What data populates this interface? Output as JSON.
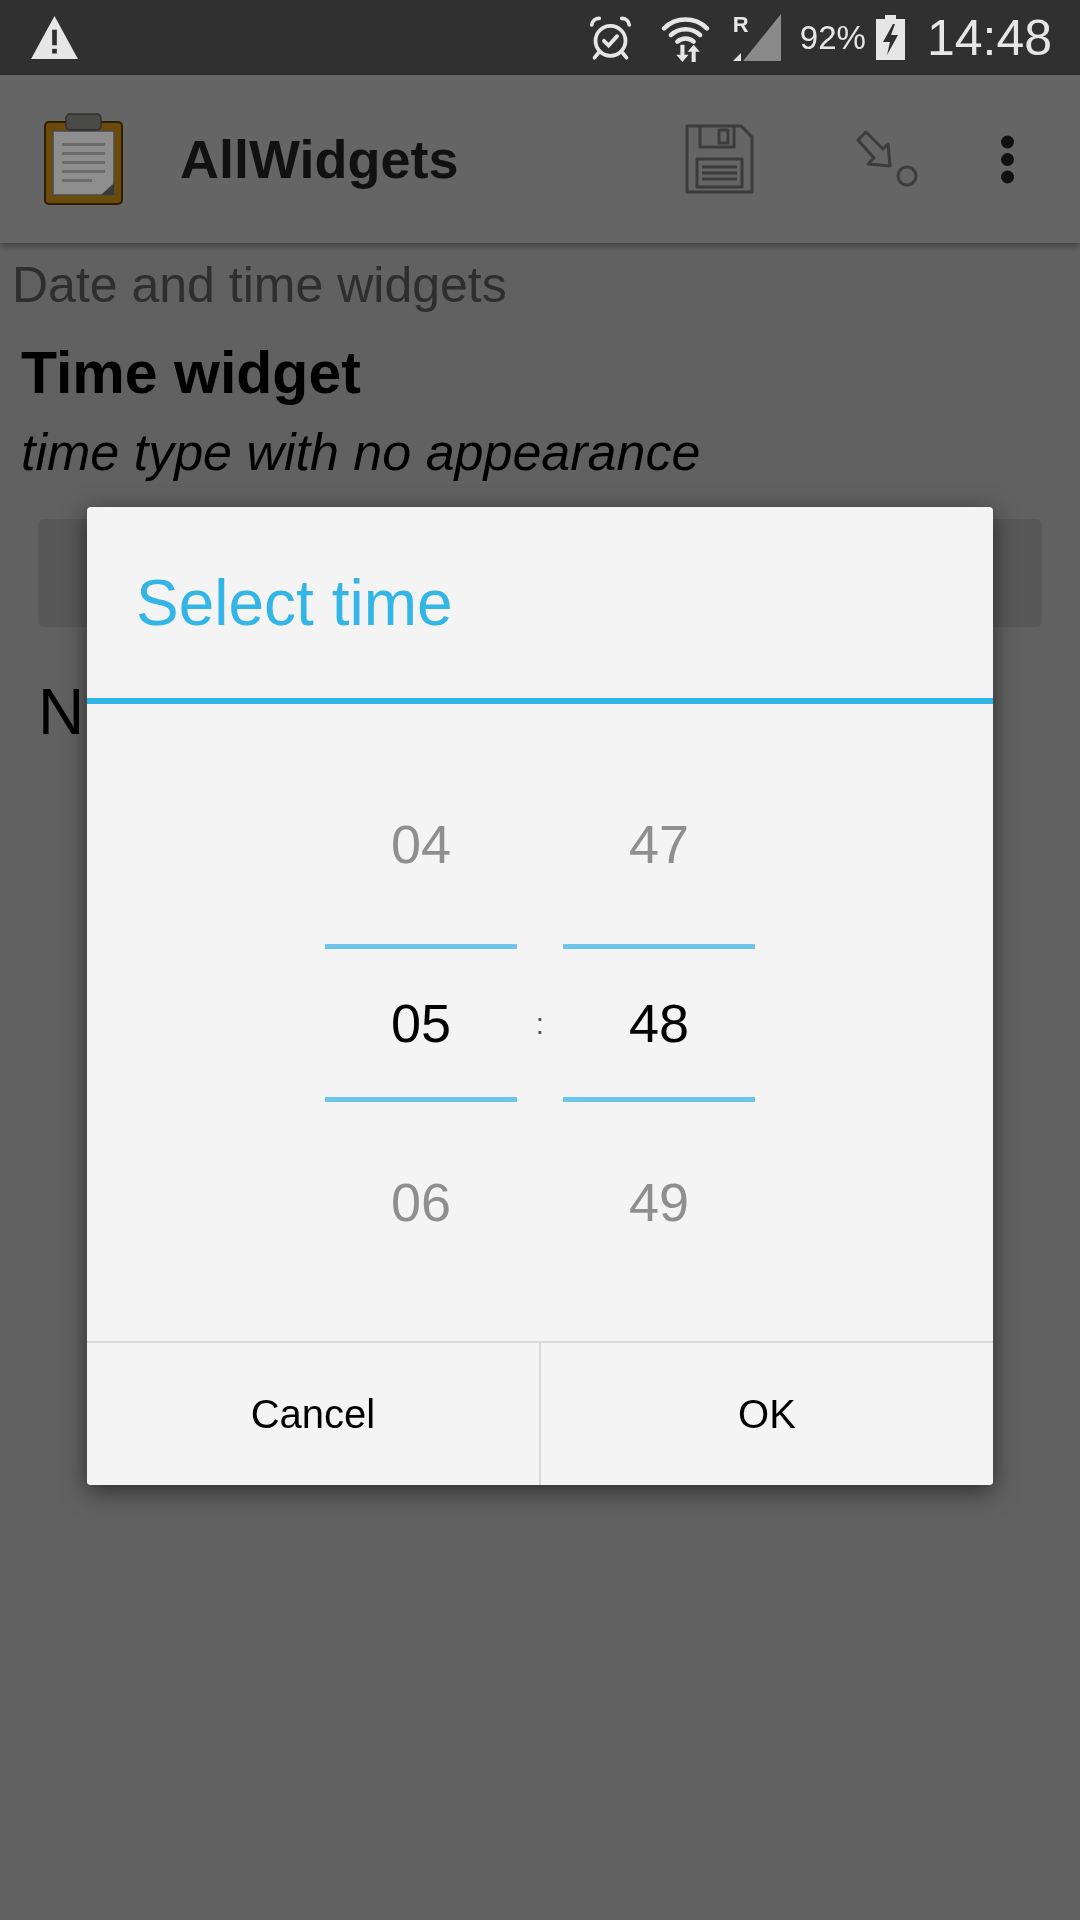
{
  "status_bar": {
    "signal_label": "R",
    "battery": "92%",
    "time": "14:48"
  },
  "toolbar": {
    "title": "AllWidgets"
  },
  "page": {
    "group_label": "Date and time widgets",
    "question": "Time widget",
    "hint": "time type with no appearance",
    "partial_text": "N"
  },
  "dialog": {
    "title": "Select time",
    "picker": {
      "columns": [
        {
          "items": [
            {
              "label": "04",
              "selected": false
            },
            {
              "label": "05",
              "selected": true
            },
            {
              "label": "06",
              "selected": false
            }
          ]
        },
        {
          "items": [
            {
              "label": "47",
              "selected": false
            },
            {
              "label": "48",
              "selected": true
            },
            {
              "label": "49",
              "selected": false
            }
          ]
        }
      ],
      "separator": ":"
    },
    "buttons": [
      "Cancel",
      "OK"
    ]
  }
}
